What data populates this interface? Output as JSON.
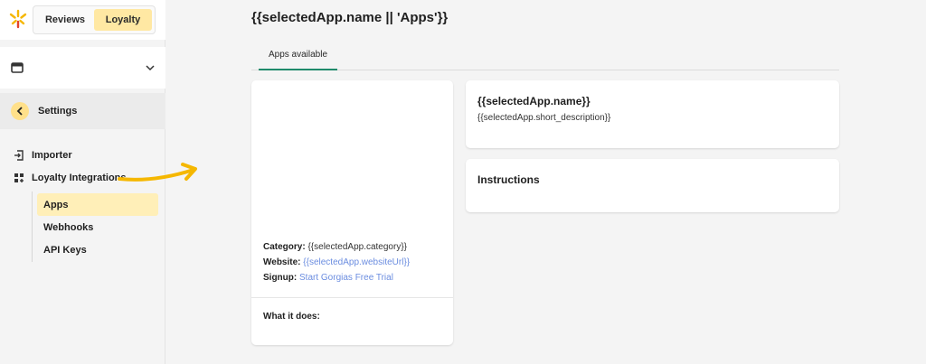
{
  "toggle": {
    "reviews": "Reviews",
    "loyalty": "Loyalty",
    "active": "Loyalty"
  },
  "sidebar": {
    "settings_label": "Settings",
    "items": [
      {
        "label": "Importer",
        "icon": "import-icon"
      },
      {
        "label": "Loyalty Integrations",
        "icon": "integrations-icon"
      }
    ],
    "sub_items": [
      {
        "label": "Apps",
        "active": true
      },
      {
        "label": "Webhooks",
        "active": false
      },
      {
        "label": "API Keys",
        "active": false
      }
    ]
  },
  "page": {
    "title": "{{selectedApp.name || 'Apps'}}"
  },
  "tabs": [
    {
      "label": "Apps available",
      "active": true
    }
  ],
  "app_card": {
    "category_label": "Category:",
    "category_value": "{{selectedApp.category}}",
    "website_label": "Website:",
    "website_value": "{{selectedApp.websiteUrl}}",
    "signup_label": "Signup:",
    "signup_value": "Start Gorgias Free Trial",
    "what_label": "What it does:"
  },
  "name_card": {
    "name": "{{selectedApp.name}}",
    "description": "{{selectedApp.short_description}}"
  },
  "instructions": {
    "title": "Instructions"
  },
  "colors": {
    "accent_yellow": "#ffe8a3",
    "tab_underline": "#1f8a6b",
    "link": "#6b8de0",
    "arrow": "#f5b700"
  }
}
